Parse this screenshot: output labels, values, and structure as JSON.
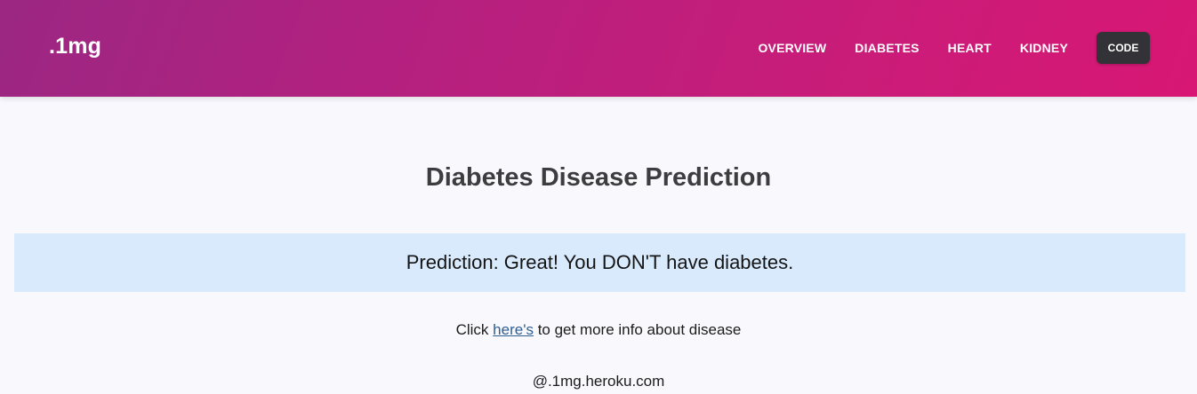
{
  "navbar": {
    "brand": ".1mg",
    "links": [
      "OVERVIEW",
      "DIABETES",
      "HEART",
      "KIDNEY"
    ],
    "code_button": "CODE"
  },
  "main": {
    "title": "Diabetes Disease Prediction",
    "prediction": "Prediction: Great! You DON'T have diabetes.",
    "info_prefix": "Click",
    "info_link": "here's",
    "info_suffix": "to get more info about disease"
  },
  "footer": {
    "text": "@.1mg.heroku.com"
  },
  "colors": {
    "navbar_gradient_start": "#9b2783",
    "navbar_gradient_end": "#d81774",
    "code_button_bg": "#333236",
    "alert_bg": "#d9eafd",
    "page_bg": "#f8f8fd",
    "link": "#2f5f8f"
  }
}
